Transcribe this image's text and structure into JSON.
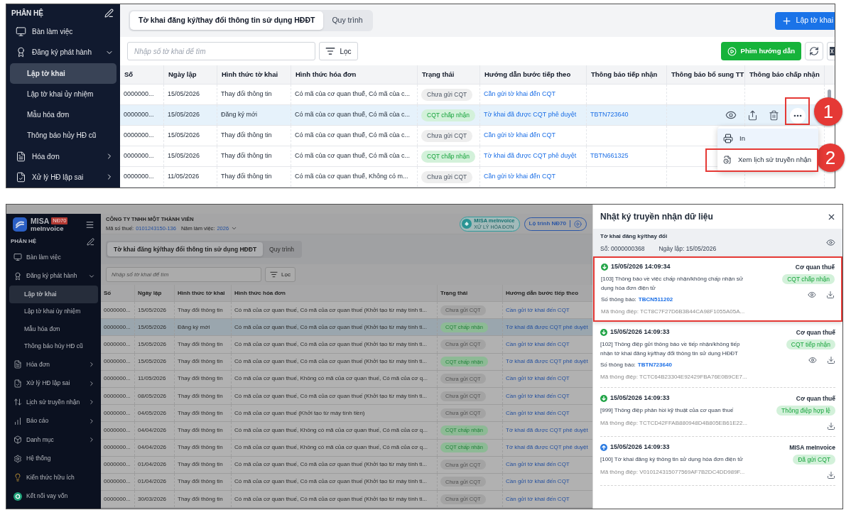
{
  "top_view": {
    "sidebar": {
      "title": "PHÂN HỆ",
      "items": [
        {
          "label": "Bàn làm việc"
        },
        {
          "label": "Đăng ký phát hành",
          "expanded": true,
          "children": [
            {
              "label": "Lập tờ khai",
              "selected": true
            },
            {
              "label": "Lập tờ khai ủy nhiệm",
              "selected": false
            },
            {
              "label": "Mẫu hóa đơn",
              "selected": false
            },
            {
              "label": "Thông báo hủy HĐ cũ",
              "selected": false
            }
          ]
        },
        {
          "label": "Hóa đơn",
          "expanded": false
        },
        {
          "label": "Xử lý HĐ lập sai",
          "expanded": false
        }
      ]
    },
    "tabs": [
      {
        "label": "Tờ khai đăng ký/thay đổi thông tin sử dụng HĐĐT",
        "selected": true
      },
      {
        "label": "Quy trình",
        "selected": false
      }
    ],
    "create_button": "Lập tờ khai",
    "search": {
      "placeholder": "Nhập số tờ khai để tìm"
    },
    "filter_button": "Lọc",
    "guide_video_button": "Phim hướng dẫn",
    "table": {
      "columns": [
        "Số",
        "Ngày lập",
        "Hình thức tờ khai",
        "Hình thức hóa đơn",
        "Trạng thái",
        "Hướng dẫn bước tiếp theo",
        "Thông báo tiếp nhận",
        "Thông báo bổ sung TT",
        "Thông báo chấp nhận"
      ],
      "rows": [
        {
          "selected": false,
          "number": "0000000...",
          "date": "15/05/2026",
          "declaration_type": "Thay đổi thông tin",
          "invoice_type": "Có mã của cơ quan thuế, Có mã của c...",
          "status": {
            "label": "Chưa gửi CQT",
            "kind": "pending"
          },
          "next_step": "Cần gửi tờ khai đến CQT"
        },
        {
          "selected": true,
          "number": "0000000...",
          "date": "15/05/2026",
          "declaration_type": "Đăng ký mới",
          "invoice_type": "Có mã của cơ quan thuế, Có mã của c...",
          "status": {
            "label": "CQT chấp nhận",
            "kind": "accepted"
          },
          "next_step": "Tờ khai đã được CQT phê duyệt",
          "receipt_notice": "TBTN723640",
          "actions": {
            "highlighted": true
          },
          "menu": [
            {
              "label": "In",
              "selected": true,
              "highlighted": false
            },
            {
              "label": "Xem lịch sử truyền nhận",
              "selected": false,
              "highlighted": true
            }
          ]
        },
        {
          "selected": false,
          "number": "0000000...",
          "date": "15/05/2026",
          "declaration_type": "Thay đổi thông tin",
          "invoice_type": "Có mã của cơ quan thuế, Có mã của c...",
          "status": {
            "label": "Chưa gửi CQT",
            "kind": "pending"
          },
          "next_step": "Cần gửi tờ khai đến CQT"
        },
        {
          "selected": false,
          "number": "0000000...",
          "date": "15/05/2026",
          "declaration_type": "Thay đổi thông tin",
          "invoice_type": "Có mã của cơ quan thuế, Có mã của c...",
          "status": {
            "label": "CQT chấp nhận",
            "kind": "accepted"
          },
          "next_step": "Tờ khai đã được CQT phê duyệt",
          "receipt_notice": "TBTN661325"
        },
        {
          "selected": false,
          "number": "0000000...",
          "date": "11/05/2026",
          "declaration_type": "Thay đổi thông tin",
          "invoice_type": "Có mã của cơ quan thuế, Không có m...",
          "status": {
            "label": "Chưa gửi CQT",
            "kind": "pending"
          },
          "next_step": "Cần gửi tờ khai đến CQT"
        }
      ]
    },
    "callouts": [
      {
        "label": "1"
      },
      {
        "label": "2"
      }
    ]
  },
  "bottom_view": {
    "dimmed": true,
    "logo": {
      "name": "MISA",
      "edition": "NĐ70",
      "product": "meInvoice"
    },
    "sidebar": {
      "title": "PHÂN HỆ",
      "items": [
        {
          "label": "Bàn làm việc"
        },
        {
          "label": "Đăng ký phát hành",
          "expanded": true,
          "children": [
            {
              "label": "Lập tờ khai",
              "selected": true
            },
            {
              "label": "Lập tờ khai ủy nhiệm",
              "selected": false
            },
            {
              "label": "Mẫu hóa đơn",
              "selected": false
            },
            {
              "label": "Thông báo hủy HĐ cũ",
              "selected": false
            }
          ]
        },
        {
          "label": "Hóa đơn",
          "expanded": false
        },
        {
          "label": "Xử lý HĐ lập sai",
          "expanded": false
        },
        {
          "label": "Lịch sử truyền nhận",
          "expanded": false
        },
        {
          "label": "Báo cáo",
          "expanded": false
        },
        {
          "label": "Danh mục",
          "expanded": false
        },
        {
          "label": "Hệ thống"
        },
        {
          "label": "Kiến thức hữu ích"
        },
        {
          "label": "Kết nối vay vốn"
        }
      ]
    },
    "company": {
      "name": "CÔNG TY TNHH MỘT THÀNH VIÊN",
      "tax_code_label": "Mã số thuế:",
      "tax_code": "0101243150-136",
      "year_label": "Năm làm việc:",
      "year": "2026"
    },
    "partner_badge": {
      "title": "MISA meInvoice",
      "subtitle": "XỬ LÝ HÓA ĐƠN"
    },
    "roadmap_button": "Lộ trình NĐ70",
    "tabs": [
      {
        "label": "Tờ khai đăng ký/thay đổi thông tin sử dụng HĐĐT",
        "selected": true
      },
      {
        "label": "Quy trình",
        "selected": false
      }
    ],
    "search": {
      "placeholder": "Nhập số tờ khai để tìm"
    },
    "filter_button": "Lọc",
    "table": {
      "columns": [
        "Số",
        "Ngày lập",
        "Hình thức tờ khai",
        "Hình thức hóa đơn",
        "Trạng thái",
        "Hướng dẫn bước tiếp theo"
      ],
      "rows": [
        {
          "selected": false,
          "number": "0000000...",
          "date": "15/05/2026",
          "declaration_type": "Thay đổi thông tin",
          "invoice_type": "Có mã của cơ quan thuế, Có mã của cơ quan thuế (Khởi tạo từ máy tính ti...",
          "status": {
            "label": "Chưa gửi CQT",
            "kind": "pending"
          },
          "next_step": "Cần gửi tờ khai đến CQT"
        },
        {
          "selected": true,
          "number": "0000000...",
          "date": "15/05/2026",
          "declaration_type": "Đăng ký mới",
          "invoice_type": "Có mã của cơ quan thuế, Có mã của cơ quan thuế (Khởi tạo từ máy tính ti...",
          "status": {
            "label": "CQT chấp nhận",
            "kind": "accepted"
          },
          "next_step": "Tờ khai đã được CQT phê duyệt"
        },
        {
          "selected": false,
          "number": "0000000...",
          "date": "15/05/2026",
          "declaration_type": "Thay đổi thông tin",
          "invoice_type": "Có mã của cơ quan thuế, Có mã của cơ quan thuế (Khởi tạo từ máy tính ti...",
          "status": {
            "label": "Chưa gửi CQT",
            "kind": "pending"
          },
          "next_step": "Cần gửi tờ khai đến CQT"
        },
        {
          "selected": false,
          "number": "0000000...",
          "date": "15/05/2026",
          "declaration_type": "Thay đổi thông tin",
          "invoice_type": "Có mã của cơ quan thuế, Có mã của cơ quan thuế (Khởi tạo từ máy tính ti...",
          "status": {
            "label": "CQT chấp nhận",
            "kind": "accepted"
          },
          "next_step": "Tờ khai đã được CQT phê duyệt"
        },
        {
          "selected": false,
          "number": "0000000...",
          "date": "11/05/2026",
          "declaration_type": "Thay đổi thông tin",
          "invoice_type": "Có mã của cơ quan thuế, Không có mã của cơ quan thuế, Có mã của cơ q...",
          "status": {
            "label": "Chưa gửi CQT",
            "kind": "pending"
          },
          "next_step": "Cần gửi tờ khai đến CQT"
        },
        {
          "selected": false,
          "number": "0000000...",
          "date": "08/05/2026",
          "declaration_type": "Thay đổi thông tin",
          "invoice_type": "Có mã của cơ quan thuế, Có mã của cơ quan thuế (Khởi tạo từ máy tính ti...",
          "status": {
            "label": "Chưa gửi CQT",
            "kind": "pending"
          },
          "next_step": "Cần gửi tờ khai đến CQT"
        },
        {
          "selected": false,
          "number": "0000000...",
          "date": "04/05/2026",
          "declaration_type": "Thay đổi thông tin",
          "invoice_type": "Có mã của cơ quan thuế (Khởi tạo từ máy tính tiền)",
          "status": {
            "label": "Chưa gửi CQT",
            "kind": "pending"
          },
          "next_step": "Cần gửi tờ khai đến CQT"
        },
        {
          "selected": false,
          "number": "0000000...",
          "date": "04/04/2026",
          "declaration_type": "Thay đổi thông tin",
          "invoice_type": "Có mã của cơ quan thuế, Không có mã của cơ quan thuế, Có mã của cơ q...",
          "status": {
            "label": "CQT chấp nhận",
            "kind": "accepted"
          },
          "next_step": "Tờ khai đã được CQT phê duyệt"
        },
        {
          "selected": false,
          "number": "0000000...",
          "date": "04/04/2026",
          "declaration_type": "Thay đổi thông tin",
          "invoice_type": "Có mã của cơ quan thuế, Không có mã của cơ quan thuế, Có mã của cơ q...",
          "status": {
            "label": "CQT chấp nhận",
            "kind": "accepted"
          },
          "next_step": "Tờ khai đã được CQT phê duyệt"
        },
        {
          "selected": false,
          "number": "0000000...",
          "date": "01/04/2026",
          "declaration_type": "Thay đổi thông tin",
          "invoice_type": "Có mã của cơ quan thuế, Có mã của cơ quan thuế (Khởi tạo từ máy tính ti...",
          "status": {
            "label": "Chưa gửi CQT",
            "kind": "pending"
          },
          "next_step": "Cần gửi tờ khai đến CQT"
        },
        {
          "selected": false,
          "number": "0000000...",
          "date": "01/04/2026",
          "declaration_type": "Thay đổi thông tin",
          "invoice_type": "Có mã của cơ quan thuế, Có mã của cơ quan thuế (Khởi tạo từ máy tính ti...",
          "status": {
            "label": "Chưa gửi CQT",
            "kind": "pending"
          },
          "next_step": "Cần gửi tờ khai đến CQT"
        },
        {
          "selected": false,
          "number": "0000000...",
          "date": "30/03/2026",
          "declaration_type": "Thay đổi thông tin",
          "invoice_type": "Có mã của cơ quan thuế, Có mã của cơ quan thuế (Khởi tạo từ máy tính ti...",
          "status": {
            "label": "Chưa gửi CQT",
            "kind": "pending"
          },
          "next_step": "Cần gửi tờ khai đến CQT"
        }
      ]
    },
    "log_panel": {
      "title": "Nhật ký truyền nhận dữ liệu",
      "summary": {
        "title": "Tờ khai đăng ký/thay đổi",
        "number": "Số: 0000000368",
        "date": "Ngày lập: 15/05/2026"
      },
      "entries": [
        {
          "kind": "received",
          "time": "15/05/2026 14:09:34",
          "source": "Cơ quan thuế",
          "message": "[103] Thông báo về việc chấp nhận/không chấp nhận sử dụng hóa đơn điện tử",
          "status": "CQT chấp nhận",
          "notice": {
            "label": "Số thông báo:",
            "value": "TBCN511202"
          },
          "message_id": "Mã thông điệp: TCT8C7F27D6B3B44CA98F1055A05A...",
          "viewable": true,
          "highlighted": true
        },
        {
          "kind": "received",
          "time": "15/05/2026 14:09:33",
          "source": "Cơ quan thuế",
          "message": "[102] Thông điệp gửi thông báo về tiếp nhận/không tiếp nhận tờ khai đăng ký/thay đổi thông tin sử dụng HĐĐT",
          "status": "CQT tiếp nhận",
          "notice": {
            "label": "Số thông báo:",
            "value": "TBTN723640"
          },
          "message_id": "Mã thông điệp: TCTC64B23304E92429FBA76E0B9CE7...",
          "viewable": true,
          "highlighted": false
        },
        {
          "kind": "received",
          "time": "15/05/2026 14:09:33",
          "source": "Cơ quan thuế",
          "message": "[999] Thông điệp phản hồi kỹ thuật của cơ quan thuế",
          "status": "Thông điệp hợp lệ",
          "message_id": "Mã thông điệp: TCTCD42FFAB880948D4B805EB61E22...",
          "viewable": false,
          "highlighted": false
        },
        {
          "kind": "sent",
          "time": "15/05/2026 14:09:33",
          "source": "MISA meInvoice",
          "message": "[100] Tờ khai đăng ký thông tin sử dụng hóa đơn điện tử",
          "status": "Đã gửi CQT",
          "message_id": "Mã thông điệp: V010124315077569AF7B2DC4DD989F...",
          "viewable": false,
          "highlighted": false
        }
      ]
    }
  }
}
